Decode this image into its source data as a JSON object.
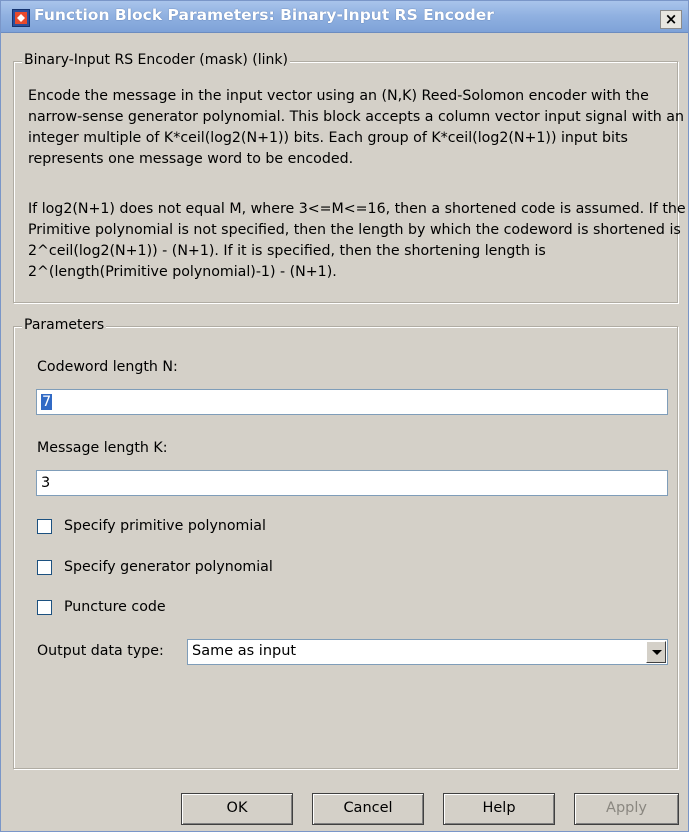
{
  "window": {
    "title": "Function Block Parameters: Binary-Input RS Encoder",
    "close_glyph": "×"
  },
  "description_group": {
    "title": "Binary-Input RS Encoder (mask) (link)",
    "paragraphs": [
      "Encode the message in the input vector using an (N,K) Reed-Solomon encoder with the narrow-sense generator polynomial.  This block accepts a column vector input signal with an integer multiple of K*ceil(log2(N+1)) bits.  Each group of K*ceil(log2(N+1)) input bits represents one message word to be encoded.",
      "If log2(N+1) does not equal M, where 3<=M<=16, then a shortened code is assumed.  If the Primitive polynomial is not specified, then the length by which the codeword is shortened is 2^ceil(log2(N+1)) - (N+1).  If it is specified, then the shortening length is 2^(length(Primitive polynomial)-1) - (N+1)."
    ]
  },
  "parameters_group": {
    "title": "Parameters",
    "codeword_label": "Codeword length N:",
    "codeword_value": "7",
    "message_label": "Message length K:",
    "message_value": "3",
    "checkboxes": [
      {
        "label": "Specify primitive polynomial",
        "checked": false
      },
      {
        "label": "Specify generator polynomial",
        "checked": false
      },
      {
        "label": "Puncture code",
        "checked": false
      }
    ],
    "output_type_label": "Output data type:",
    "output_type_value": "Same as input"
  },
  "buttons": {
    "ok": "OK",
    "cancel": "Cancel",
    "help": "Help",
    "apply": "Apply"
  },
  "icons": {
    "app": "simulink-block-icon",
    "close": "close-icon",
    "dropdown": "chevron-down-icon"
  },
  "colors": {
    "title_bar": "#8fb0e0",
    "selection": "#316ac5",
    "window_bg": "#d4d0c8",
    "disabled_text": "#8a8780"
  }
}
